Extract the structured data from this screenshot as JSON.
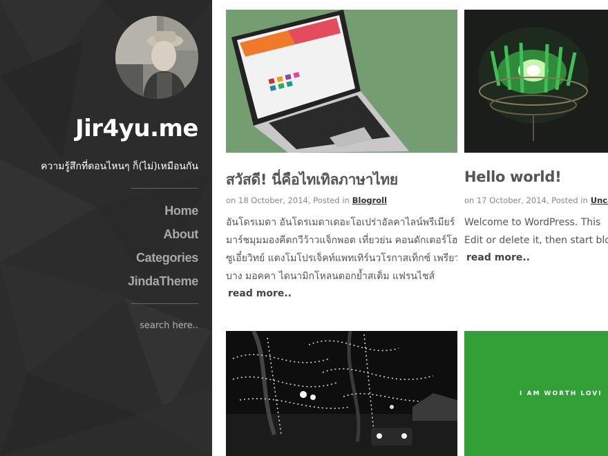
{
  "site": {
    "title": "Jir4yu.me",
    "tagline": "ความรู้สึกที่ตอนไหนๆ ก็(ไม่)เหมือนกัน"
  },
  "nav": {
    "items": [
      {
        "label": "Home"
      },
      {
        "label": "About"
      },
      {
        "label": "Categories"
      },
      {
        "label": "JindaTheme"
      }
    ]
  },
  "search": {
    "placeholder": "search here.."
  },
  "posts": [
    {
      "title": "สวัสดี! นี่คือไทเทิลภาษาไทย",
      "meta_prefix": "on 18 October, 2014, Posted in",
      "category": "Blogroll",
      "excerpt_lines": [
        "อันโดรเมดา อันโดรเมดาเดอะโอเปร่าอัลคาไลน์พรีเมียร์",
        "มาร์ชมุมมองคีตกวีว้าวแจ็กพอต เที่ยวย่น คอนดักเตอร์โฮป",
        "ซูเอี๋ยวิทย์ แตงโมโปรเจ็คท์แพทเทิร์นวโรกาสเท็กซ์ เพรียว",
        "บาง มอคคา ไดนามิกโหลนตอกย้ำสเต็ม แฟรนไชส์"
      ],
      "read_more": "read more.."
    },
    {
      "title": "Hello world!",
      "meta_prefix": "on 17 October, 2014, Posted in",
      "category": "Unca",
      "excerpt_lines": [
        "Welcome to WordPress. This",
        "Edit or delete it, then start blo"
      ],
      "read_more": "read more.."
    },
    {
      "thumb": "night-street-lights"
    },
    {
      "thumb_text": "I AM WORTH LOVI"
    }
  ],
  "colors": {
    "sidebar_bg": "#2d2d2d",
    "nav_text": "#a9a9a9",
    "post_title": "#555555",
    "green_card": "#33a037"
  }
}
